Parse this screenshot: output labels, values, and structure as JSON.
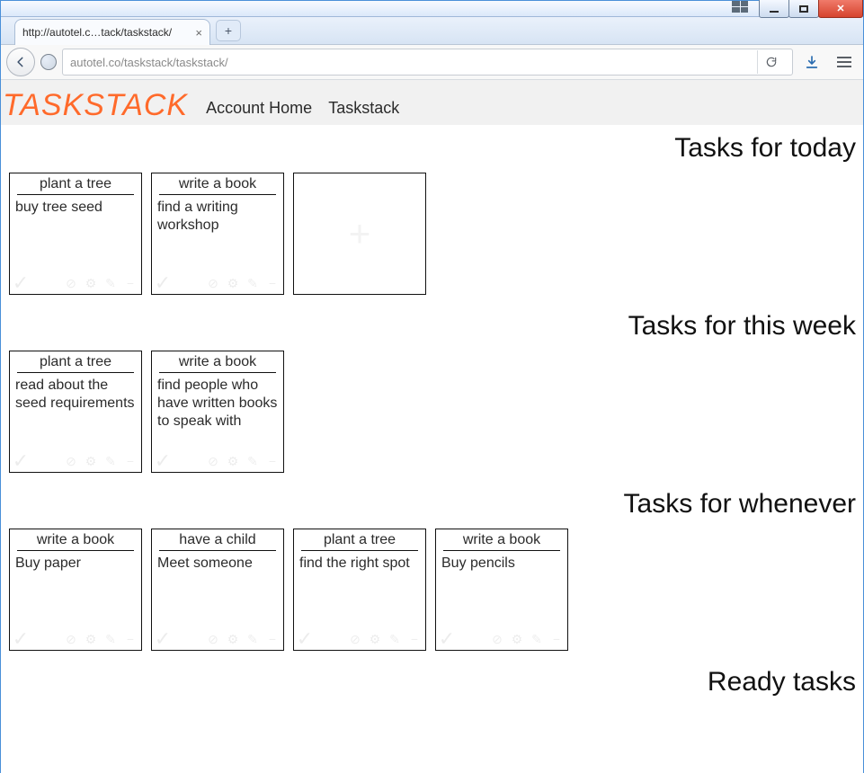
{
  "browser": {
    "tab_title": "http://autotel.c…tack/taskstack/",
    "url_host": "autotel.co",
    "url_path": "/taskstack/taskstack/"
  },
  "app": {
    "logo": "TASKSTACK",
    "nav": {
      "account_home": "Account Home",
      "taskstack": "Taskstack"
    }
  },
  "sections": {
    "today": {
      "title": "Tasks for today"
    },
    "week": {
      "title": "Tasks for this week"
    },
    "whenever": {
      "title": "Tasks for whenever"
    },
    "ready": {
      "title": "Ready tasks"
    }
  },
  "cards": {
    "today": [
      {
        "goal": "plant a tree",
        "task": "buy tree seed"
      },
      {
        "goal": "write a book",
        "task": "find a writing workshop"
      }
    ],
    "week": [
      {
        "goal": "plant a tree",
        "task": "read about the seed requirements"
      },
      {
        "goal": "write a book",
        "task": "find people who have written books to speak with"
      }
    ],
    "whenever": [
      {
        "goal": "write a book",
        "task": "Buy paper"
      },
      {
        "goal": "have a child",
        "task": "Meet someone"
      },
      {
        "goal": "plant a tree",
        "task": "find the right spot"
      },
      {
        "goal": "write a book",
        "task": "Buy pencils"
      }
    ]
  }
}
